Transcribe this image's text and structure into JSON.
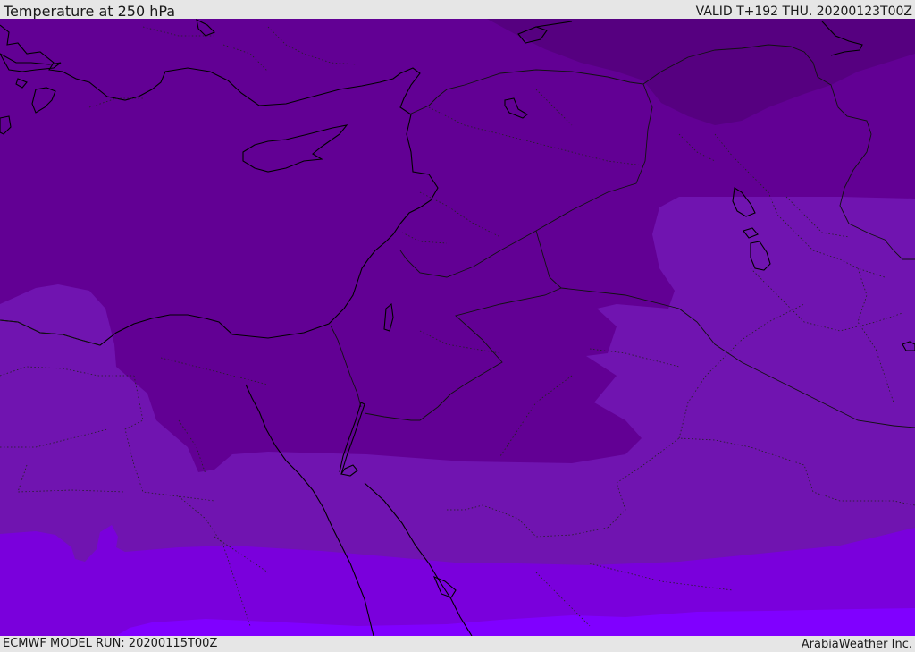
{
  "header": {
    "title": "Temperature at 250 hPa",
    "valid": "VALID T+192 THU. 20200123T00Z"
  },
  "footer": {
    "model_run": "ECMWF MODEL RUN: 20200115T00Z",
    "credit": "ArabiaWeather Inc."
  },
  "map": {
    "variable": "temperature",
    "level": "250 hPa",
    "region": "Eastern Mediterranean / Middle East",
    "colors": {
      "band_coldest": "#560080",
      "band_cold": "#620094",
      "band_mid": "#7014b0",
      "band_warm": "#7a00dc",
      "band_warmest": "#8000ff",
      "coastline": "#000000",
      "borders": "#222222"
    }
  }
}
